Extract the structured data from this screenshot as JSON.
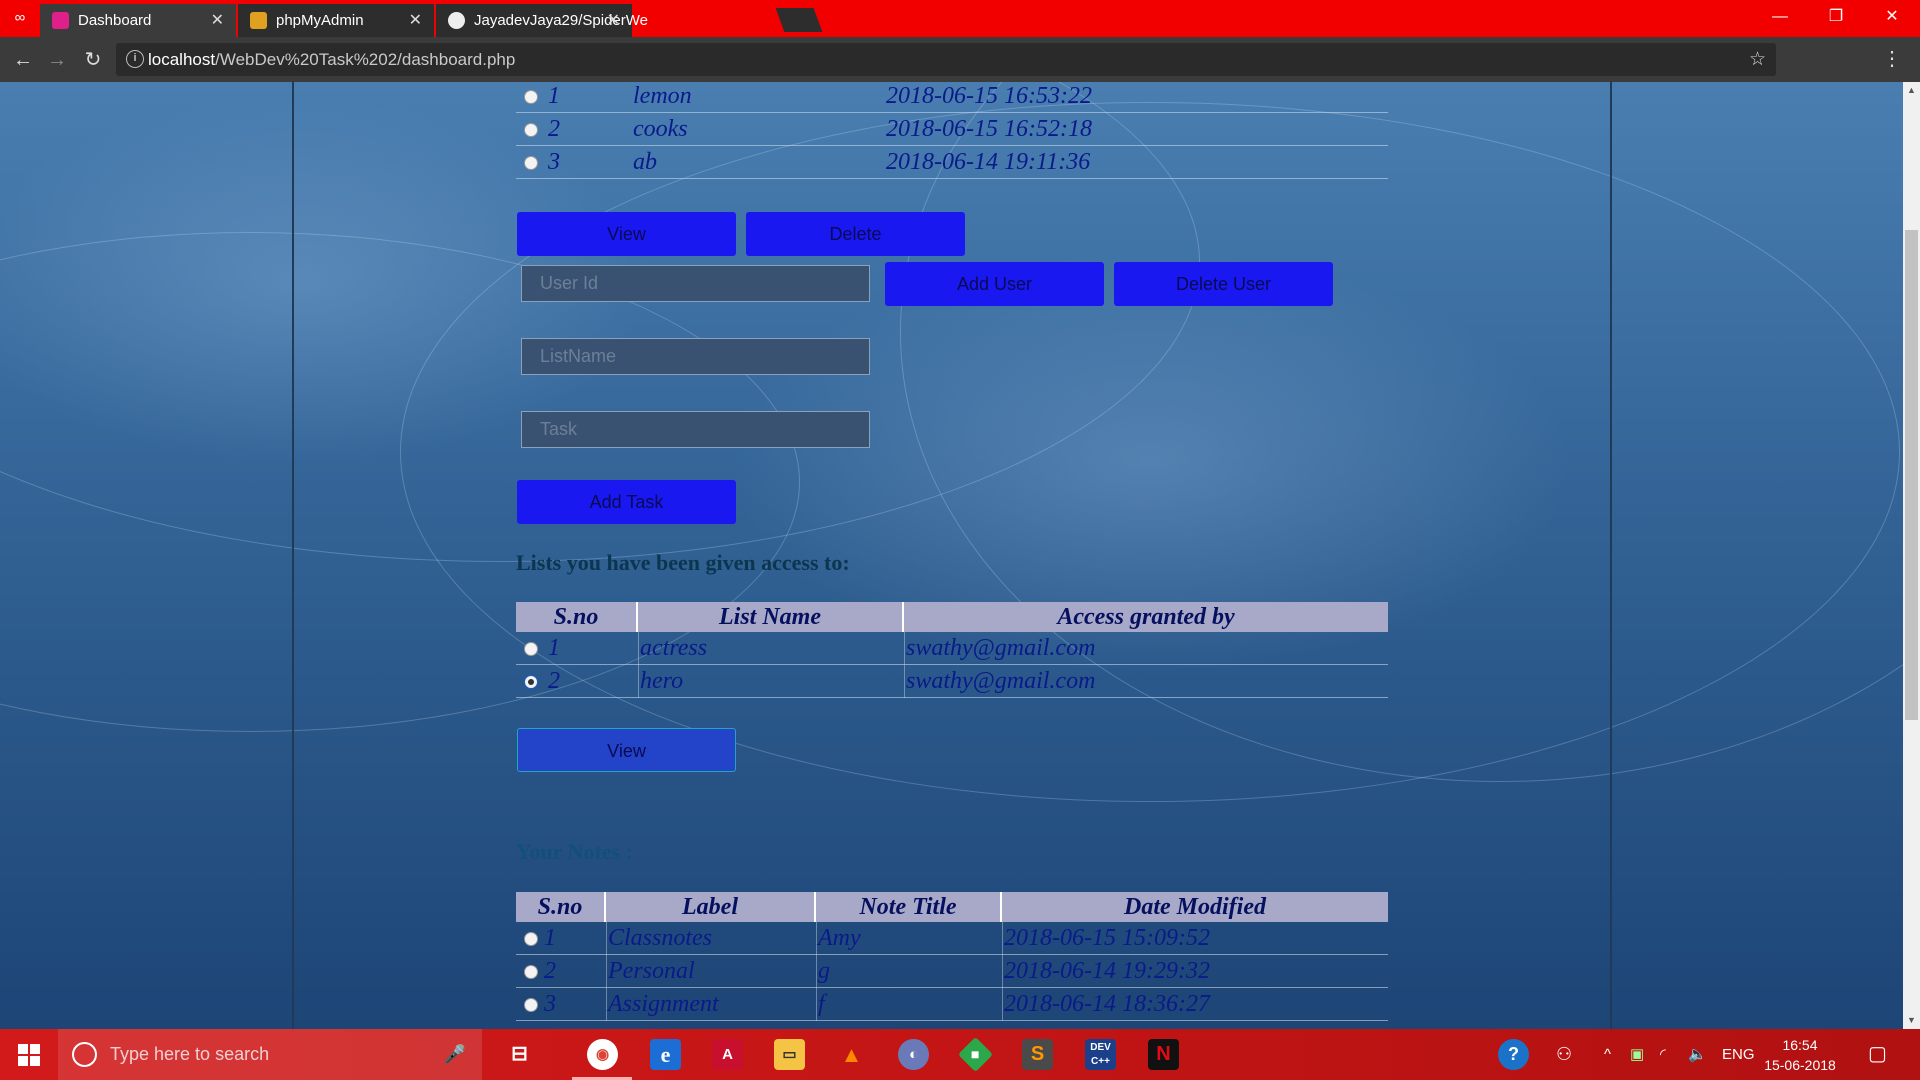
{
  "browser": {
    "tabs": [
      {
        "title": "Dashboard",
        "icon": "dashboard-favicon",
        "active": true
      },
      {
        "title": "phpMyAdmin",
        "icon": "phpmyadmin-favicon",
        "active": false
      },
      {
        "title": "JayadevJaya29/SpiderWe",
        "icon": "github-favicon",
        "active": false
      }
    ],
    "url_host": "localhost",
    "url_path": "/WebDev%20Task%202/dashboard.php"
  },
  "my_lists": {
    "rows": [
      {
        "sno": "1",
        "name": "lemon",
        "date": "2018-06-15 16:53:22"
      },
      {
        "sno": "2",
        "name": "cooks",
        "date": "2018-06-15 16:52:18"
      },
      {
        "sno": "3",
        "name": "ab",
        "date": "2018-06-14 19:11:36"
      }
    ],
    "view_label": "View",
    "delete_label": "Delete",
    "user_id_placeholder": "User Id",
    "add_user_label": "Add User",
    "delete_user_label": "Delete User",
    "list_name_placeholder": "ListName",
    "task_placeholder": "Task",
    "add_task_label": "Add Task"
  },
  "shared_lists": {
    "heading": "Lists you have been given access to:",
    "columns": [
      "S.no",
      "List Name",
      "Access granted by"
    ],
    "rows": [
      {
        "sno": "1",
        "name": "actress",
        "by": "swathy@gmail.com",
        "checked": false
      },
      {
        "sno": "2",
        "name": "hero",
        "by": "swathy@gmail.com",
        "checked": true
      }
    ],
    "view_label": "View"
  },
  "notes": {
    "heading": "Your Notes :",
    "columns": [
      "S.no",
      "Label",
      "Note Title",
      "Date Modified"
    ],
    "rows": [
      {
        "sno": "1",
        "label": "Classnotes",
        "title": "Amy",
        "date": "2018-06-15 15:09:52"
      },
      {
        "sno": "2",
        "label": "Personal",
        "title": "g",
        "date": "2018-06-14 19:29:32"
      },
      {
        "sno": "3",
        "label": "Assignment",
        "title": "f",
        "date": "2018-06-14 18:36:27"
      }
    ]
  },
  "taskbar": {
    "search_placeholder": "Type here to search",
    "apps": [
      "chrome-icon",
      "edge-icon",
      "acrobat-icon",
      "file-explorer-icon",
      "vlc-icon",
      "app-icon",
      "git-icon",
      "sublime-icon",
      "devcpp-icon",
      "netflix-icon"
    ],
    "language": "ENG",
    "time": "16:54",
    "date": "15-06-2018"
  },
  "colors": {
    "tab_strip": "#f20000",
    "button_blue": "#1a18f0",
    "taskbar_red": "#c01414"
  }
}
